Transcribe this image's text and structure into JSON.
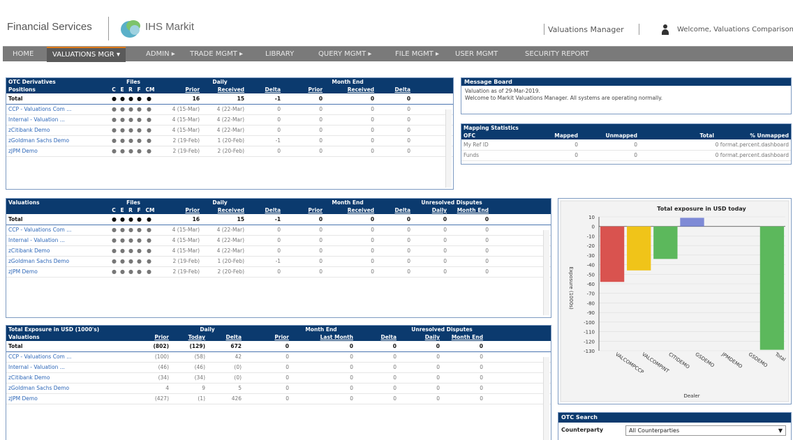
{
  "header": {
    "brand": "Financial Services",
    "logo": "IHS Markit",
    "app_name": "Valuations Manager",
    "welcome": "Welcome, Valuations Comparison"
  },
  "nav": [
    "HOME",
    "VALUATIONS MGR ▾",
    "ADMIN ▸",
    "TRADE MGMT ▸",
    "LIBRARY",
    "QUERY MGMT ▸",
    "FILE MGMT ▸",
    "USER MGMT",
    "SECURITY REPORT"
  ],
  "otc": {
    "h1": [
      "OTC Derivatives",
      "Files",
      "Daily",
      "Month End"
    ],
    "h2": [
      "Positions",
      "C",
      "E",
      "R",
      "F",
      "CM",
      "Prior",
      "Received",
      "Delta",
      "Prior",
      "Received",
      "Delta"
    ],
    "total": [
      "Total",
      "16",
      "15",
      "-1",
      "0",
      "0",
      "0"
    ],
    "rows": [
      [
        "CCP - Valuations Com ...",
        "rd",
        "rd",
        "rd",
        "rd",
        "rd",
        "4 (15-Mar)",
        "4 (22-Mar)",
        "0",
        "0",
        "0",
        "0"
      ],
      [
        "Internal - Valuation ...",
        "rd",
        "rd",
        "rd",
        "rd",
        "rd",
        "4 (15-Mar)",
        "4 (22-Mar)",
        "0",
        "0",
        "0",
        "0"
      ],
      [
        "zCitibank Demo",
        "g",
        "g",
        "g",
        "rd",
        "rd",
        "4 (15-Mar)",
        "4 (22-Mar)",
        "0",
        "0",
        "0",
        "0"
      ],
      [
        "zGoldman Sachs Demo",
        "rd",
        "rd",
        "rd",
        "rd",
        "rd",
        "2 (19-Feb)",
        "1 (20-Feb)",
        "-1",
        "0",
        "0",
        "0"
      ],
      [
        "zJPM Demo",
        "rd",
        "rd",
        "rd",
        "rd",
        "rd",
        "2 (19-Feb)",
        "2 (20-Feb)",
        "0",
        "0",
        "0",
        "0"
      ]
    ]
  },
  "msg": {
    "title": "Message Board",
    "l1": "Valuation as of 29-Mar-2019.",
    "l2": "Welcome to Markit Valuations Manager. All systems are operating normally."
  },
  "map": {
    "title": "Mapping Statistics",
    "cols": [
      "OFC",
      "Mapped",
      "Unmapped",
      "Total",
      "% Unmapped"
    ],
    "rows": [
      [
        "My Ref ID",
        "0",
        "0",
        "0 format.percent.dashboard"
      ],
      [
        "Funds",
        "0",
        "0",
        "0 format.percent.dashboard"
      ]
    ]
  },
  "val": {
    "h1": [
      "Valuations",
      "Files",
      "Daily",
      "Month End",
      "Unresolved Disputes"
    ],
    "h2": [
      "C",
      "E",
      "R",
      "F",
      "CM",
      "Prior",
      "Received",
      "Delta",
      "Prior",
      "Received",
      "Delta",
      "Daily",
      "Month End"
    ],
    "total": [
      "Total",
      "16",
      "15",
      "-1",
      "0",
      "0",
      "0",
      "0",
      "0"
    ],
    "rows": [
      [
        "CCP - Valuations Com ...",
        "rd",
        "rd",
        "rd",
        "rd",
        "rd",
        "4 (15-Mar)",
        "4 (22-Mar)",
        "0",
        "0",
        "0",
        "0",
        "0",
        "0"
      ],
      [
        "Internal - Valuation ...",
        "rd",
        "rd",
        "rd",
        "rd",
        "rd",
        "4 (15-Mar)",
        "4 (22-Mar)",
        "0",
        "0",
        "0",
        "0",
        "0",
        "0"
      ],
      [
        "zCitibank Demo",
        "g",
        "g",
        "g",
        "rd",
        "rd",
        "4 (15-Mar)",
        "4 (22-Mar)",
        "0",
        "0",
        "0",
        "0",
        "0",
        "0"
      ],
      [
        "zGoldman Sachs Demo",
        "rd",
        "rd",
        "rd",
        "rd",
        "rd",
        "2 (19-Feb)",
        "1 (20-Feb)",
        "-1",
        "0",
        "0",
        "0",
        "0",
        "0"
      ],
      [
        "zJPM Demo",
        "rd",
        "rd",
        "rd",
        "rd",
        "rd",
        "2 (19-Feb)",
        "2 (20-Feb)",
        "0",
        "0",
        "0",
        "0",
        "0",
        "0"
      ]
    ]
  },
  "exp": {
    "h1": [
      "Total Exposure in USD (1000's)",
      "Daily",
      "Month End",
      "Unresolved Disputes"
    ],
    "h2": [
      "Valuations",
      "Prior",
      "Today",
      "Delta",
      "Prior",
      "Last Month",
      "Delta",
      "Daily",
      "Month End"
    ],
    "total": [
      "Total",
      "(802)",
      "(129)",
      "672",
      "0",
      "0",
      "0",
      "0",
      "0"
    ],
    "rows": [
      [
        "CCP - Valuations Com ...",
        "(100)",
        "(58)",
        "42",
        "0",
        "0",
        "0",
        "0",
        "0"
      ],
      [
        "Internal - Valuation ...",
        "(46)",
        "(46)",
        "(0)",
        "0",
        "0",
        "0",
        "0",
        "0"
      ],
      [
        "zCitibank Demo",
        "(34)",
        "(34)",
        "(0)",
        "0",
        "0",
        "0",
        "0",
        "0"
      ],
      [
        "zGoldman Sachs Demo",
        "4",
        "9",
        "5",
        "0",
        "0",
        "0",
        "0",
        "0"
      ],
      [
        "zJPM Demo",
        "(427)",
        "(1)",
        "426",
        "0",
        "0",
        "0",
        "0",
        "0"
      ]
    ]
  },
  "search": {
    "title": "OTC Search",
    "label": "Counterparty",
    "value": "All Counterparties"
  },
  "chart_data": {
    "type": "bar",
    "title": "Total exposure in USD today",
    "xlabel": "Dealer",
    "ylabel": "Exposure (1000s)",
    "ylim": [
      -130,
      10
    ],
    "categories": [
      "VALCOMPCCP",
      "VALCOMPINT",
      "CITIDEMO",
      "GSDEMO",
      "JPMDEMO",
      "GSDEMO",
      "Total"
    ],
    "values": [
      -58,
      -46,
      -34,
      9,
      0,
      0,
      -129
    ],
    "colors": [
      "#d9534f",
      "#f0c419",
      "#5cb85c",
      "#7e8ad6",
      "#7e8ad6",
      "#7e8ad6",
      "#5cb85c"
    ]
  }
}
